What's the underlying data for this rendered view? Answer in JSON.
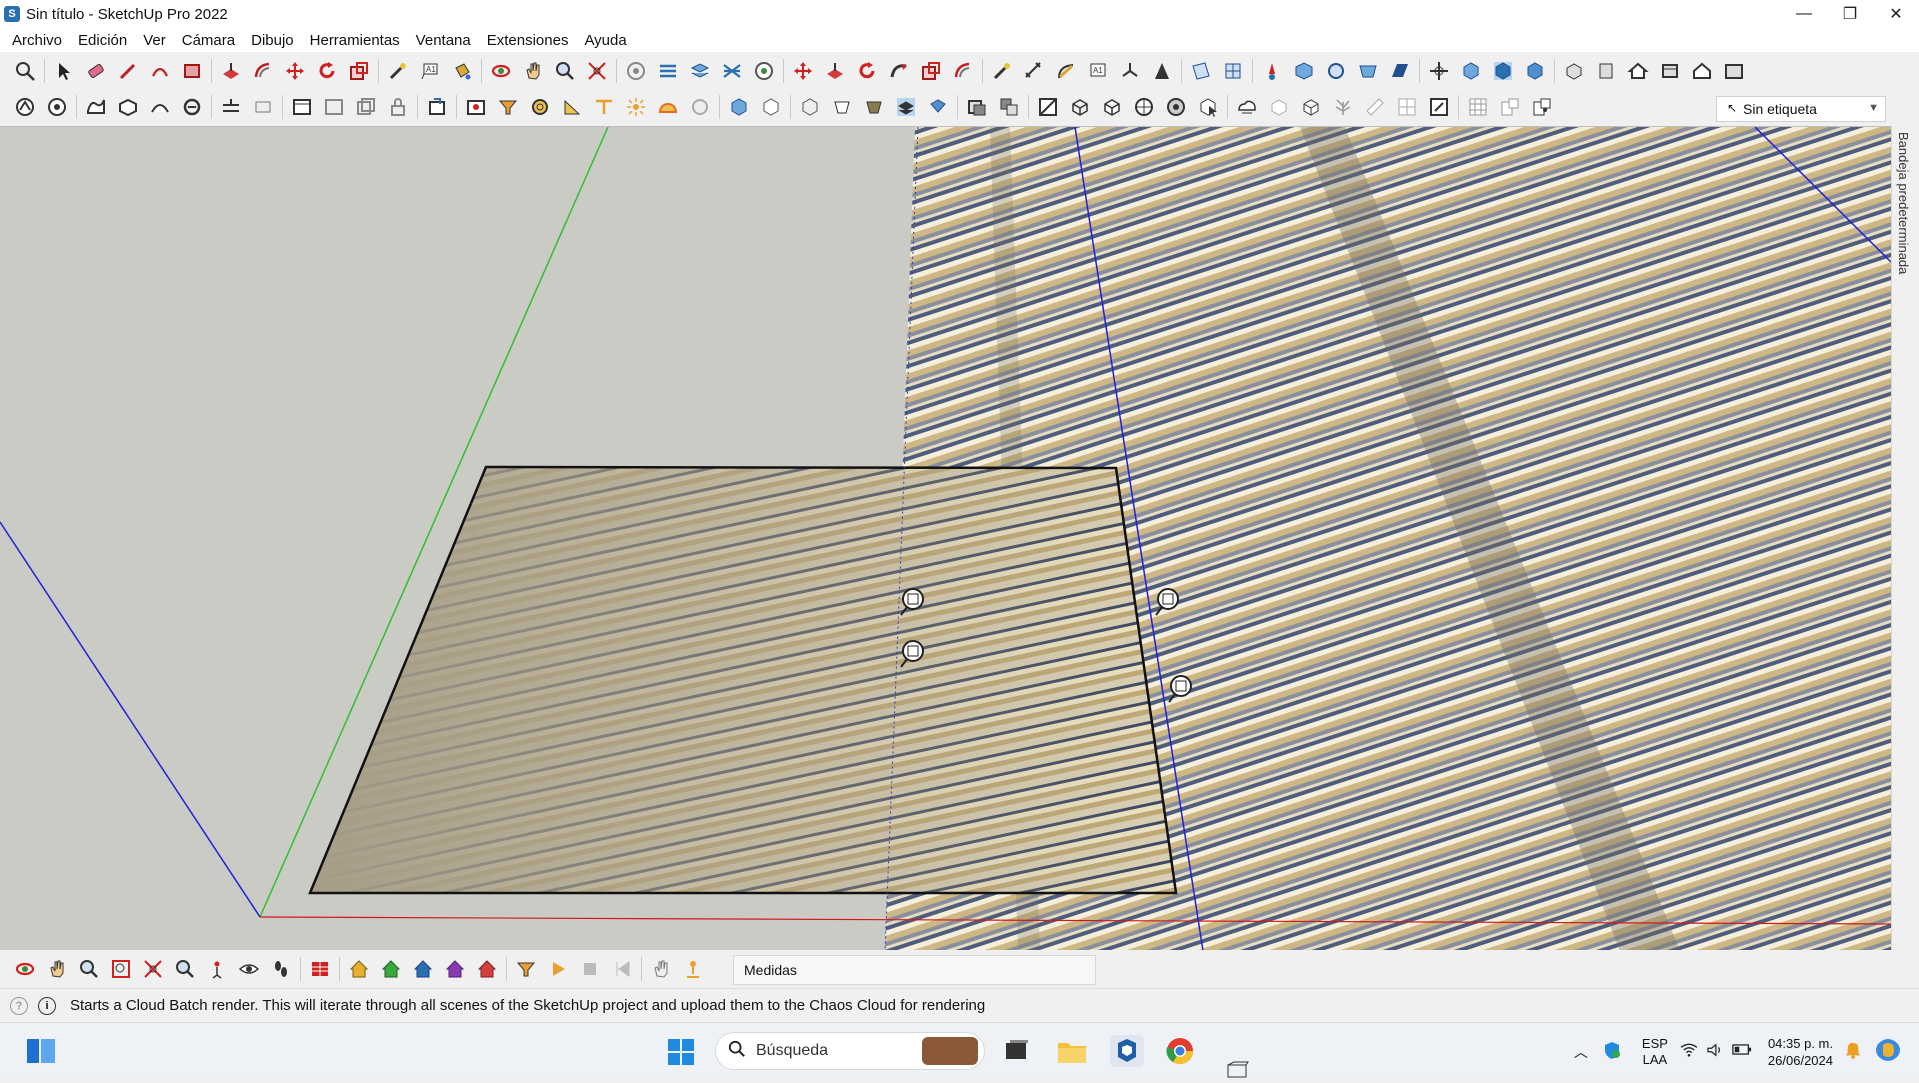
{
  "window": {
    "title": "Sin título - SketchUp Pro 2022",
    "controls": [
      "—",
      "❐",
      "✕"
    ]
  },
  "menu": [
    "Archivo",
    "Edición",
    "Ver",
    "Cámara",
    "Dibujo",
    "Herramientas",
    "Ventana",
    "Extensiones",
    "Ayuda"
  ],
  "toolbar": {
    "tag_selector": "Sin etiqueta"
  },
  "tray": {
    "label": "Bandeja predeterminada"
  },
  "measurements": {
    "label": "Medidas"
  },
  "status": {
    "message": "Starts a Cloud Batch render. This will iterate through all scenes of the SketchUp project and upload them to the Chaos Cloud for rendering"
  },
  "taskbar": {
    "search_placeholder": "Búsqueda",
    "lang_top": "ESP",
    "lang_bottom": "LAA",
    "time": "04:35 p. m.",
    "date": "26/06/2024"
  },
  "colors": {
    "accent": "#1f6fbf",
    "axis_green": "#2fbf2f",
    "axis_blue": "#2020d8",
    "axis_red": "#d01a1a",
    "sky": "#cbcbc6"
  }
}
